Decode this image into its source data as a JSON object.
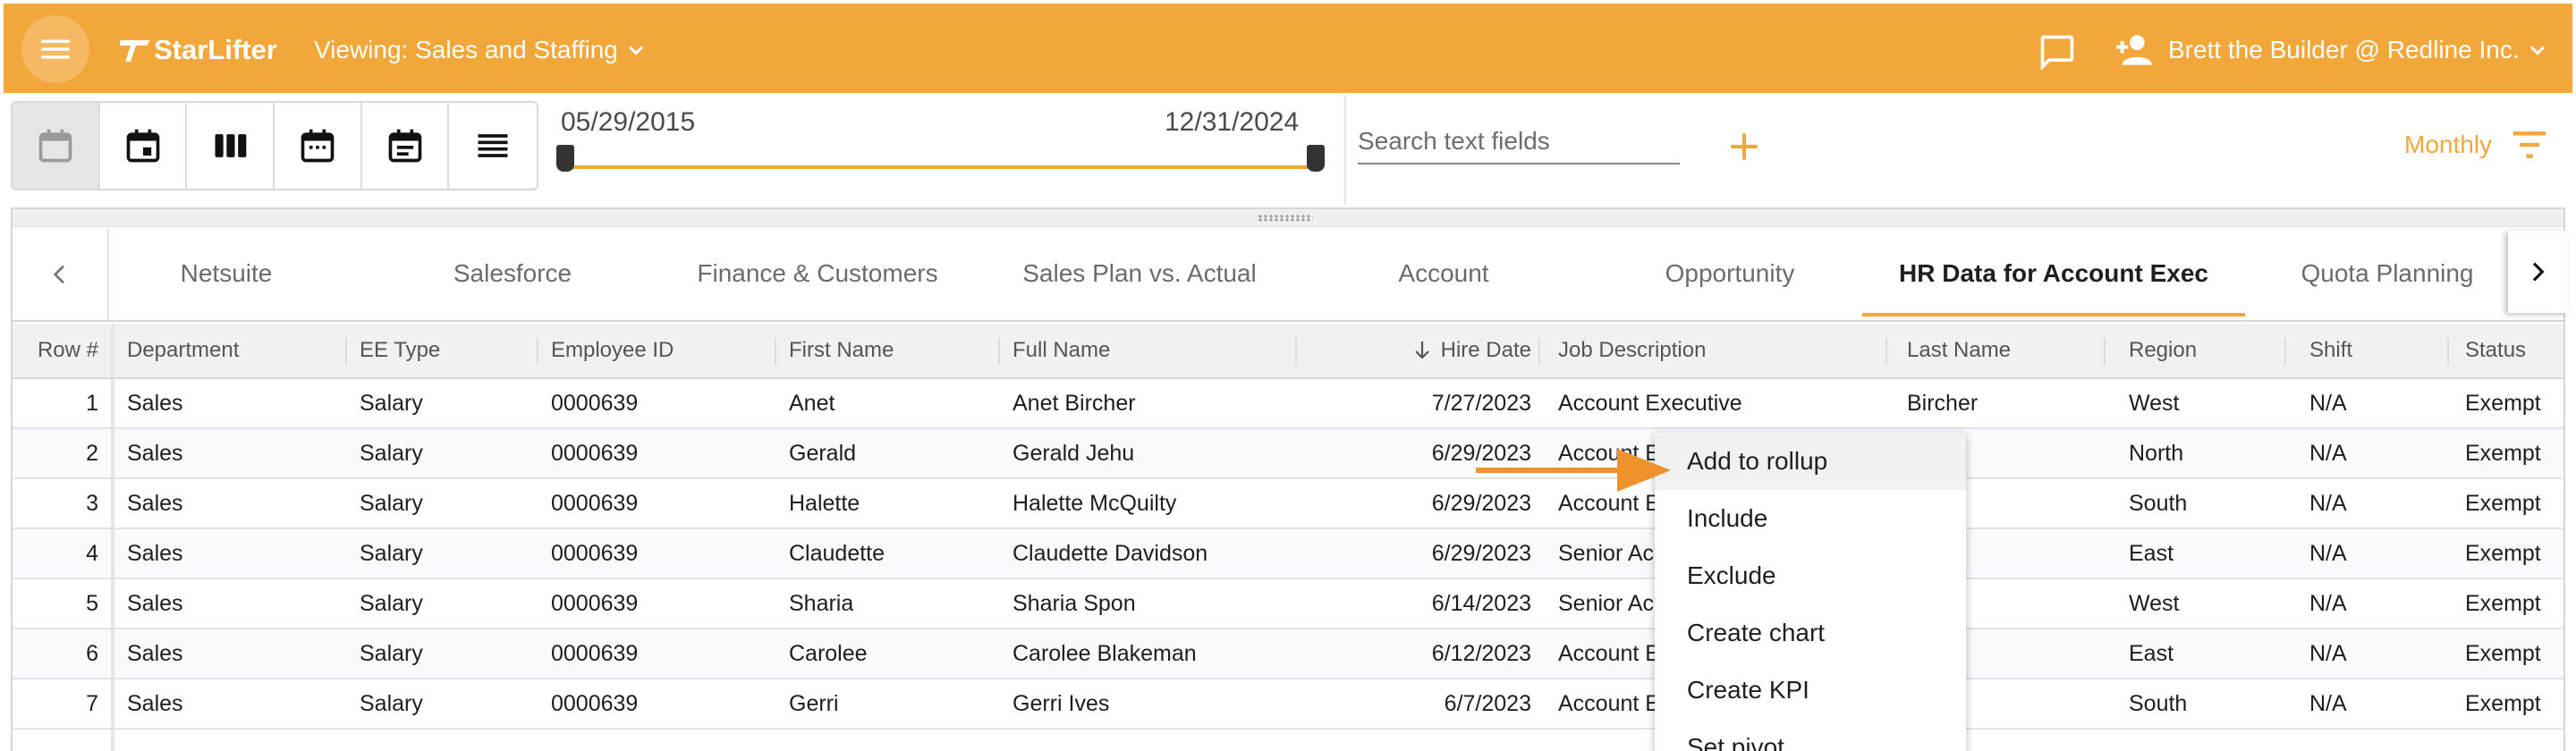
{
  "header": {
    "app_name": "StarLifter",
    "viewing_label": "Viewing: Sales and Staffing",
    "user_label": "Brett the Builder @ Redline Inc.",
    "icons": [
      "menu-icon",
      "logo-icon",
      "chevron-down-icon",
      "chat-icon",
      "add-user-icon",
      "chevron-down-icon"
    ]
  },
  "toolbar": {
    "view_buttons": [
      "calendar-blank-icon",
      "calendar-day-icon",
      "columns-icon",
      "calendar-month-icon",
      "calendar-list-icon",
      "list-icon"
    ],
    "date_start": "05/29/2015",
    "date_end": "12/31/2024",
    "search_placeholder": "Search text fields",
    "period_label": "Monthly"
  },
  "tabs": [
    "Netsuite",
    "Salesforce",
    "Finance & Customers",
    "Sales Plan vs. Actual",
    "Account",
    "Opportunity",
    "HR Data for Account Exec",
    "Quota Planning"
  ],
  "active_tab": "HR Data for Account Exec",
  "table": {
    "columns": [
      "Row #",
      "Department",
      "EE Type",
      "Employee ID",
      "First Name",
      "Full Name",
      "Hire Date",
      "Job Description",
      "Last Name",
      "Region",
      "Shift",
      "Status"
    ],
    "sorted_column": "Hire Date",
    "sort_direction": "descending",
    "rows": [
      [
        "1",
        "Sales",
        "Salary",
        "0000639",
        "Anet",
        "Anet Bircher",
        "7/27/2023",
        "Account Executive",
        "Bircher",
        "West",
        "N/A",
        "Exempt"
      ],
      [
        "2",
        "Sales",
        "Salary",
        "0000639",
        "Gerald",
        "Gerald Jehu",
        "6/29/2023",
        "Account E",
        "",
        "North",
        "N/A",
        "Exempt"
      ],
      [
        "3",
        "Sales",
        "Salary",
        "0000639",
        "Halette",
        "Halette McQuilty",
        "6/29/2023",
        "Account E",
        "uilty",
        "South",
        "N/A",
        "Exempt"
      ],
      [
        "4",
        "Sales",
        "Salary",
        "0000639",
        "Claudette",
        "Claudette Davidson",
        "6/29/2023",
        "Senior Ac",
        "dson",
        "East",
        "N/A",
        "Exempt"
      ],
      [
        "5",
        "Sales",
        "Salary",
        "0000639",
        "Sharia",
        "Sharia Spon",
        "6/14/2023",
        "Senior Ac",
        "",
        "West",
        "N/A",
        "Exempt"
      ],
      [
        "6",
        "Sales",
        "Salary",
        "0000639",
        "Carolee",
        "Carolee Blakeman",
        "6/12/2023",
        "Account E",
        "man",
        "East",
        "N/A",
        "Exempt"
      ],
      [
        "7",
        "Sales",
        "Salary",
        "0000639",
        "Gerri",
        "Gerri Ives",
        "6/7/2023",
        "Account E",
        "",
        "South",
        "N/A",
        "Exempt"
      ]
    ]
  },
  "context_menu": {
    "items": [
      "Add to rollup",
      "Include",
      "Exclude",
      "Create chart",
      "Create KPI",
      "Set pivot"
    ],
    "highlighted": "Add to rollup"
  },
  "colors": {
    "brand_orange": "#f2a73b",
    "header_text": "#ffffff",
    "active_tab_underline": "#f2a73b",
    "annotation_arrow": "#f0922b"
  }
}
